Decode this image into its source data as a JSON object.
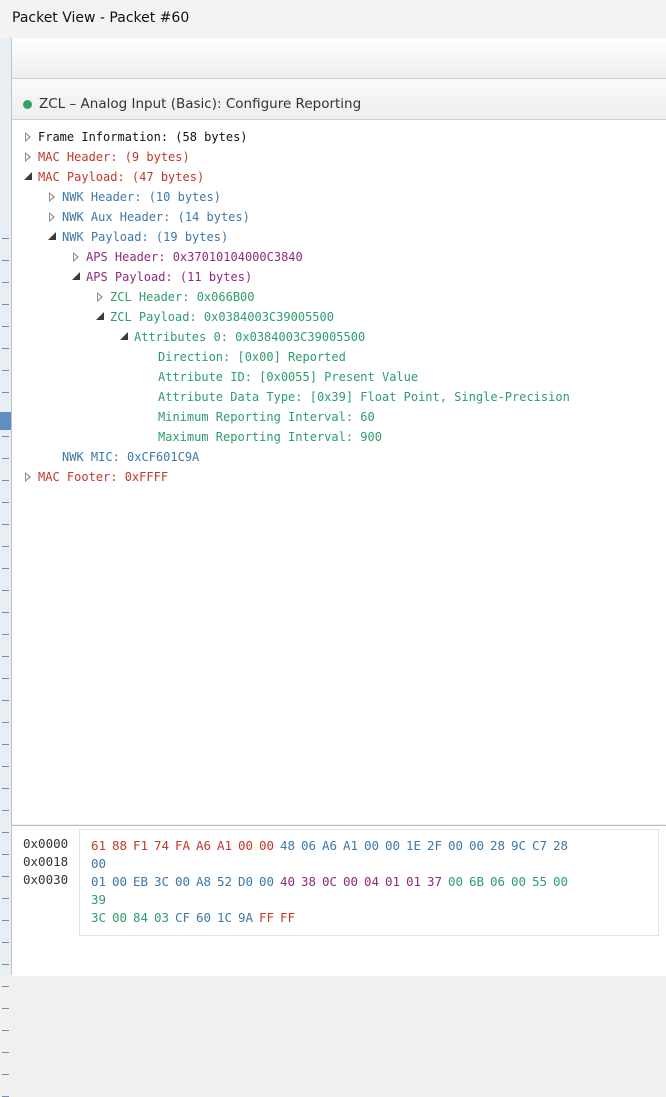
{
  "window": {
    "title": "Packet View - Packet #60"
  },
  "summary": {
    "title": "ZCL – Analog Input (Basic): Configure Reporting",
    "status_color": "#2fa36b"
  },
  "tree": [
    {
      "label": "Frame Information: (58 bytes)",
      "toggle": "collapsed",
      "color": "black"
    },
    {
      "label": "MAC Header: (9 bytes)",
      "toggle": "collapsed",
      "color": "red"
    },
    {
      "label": "MAC Payload: (47 bytes)",
      "toggle": "expanded",
      "color": "red"
    },
    {
      "label": "NWK Header: (10 bytes)",
      "toggle": "collapsed",
      "color": "blue"
    },
    {
      "label": "NWK Aux Header: (14 bytes)",
      "toggle": "collapsed",
      "color": "blue"
    },
    {
      "label": "NWK Payload: (19 bytes)",
      "toggle": "expanded",
      "color": "blue"
    },
    {
      "label": "APS Header: 0x37010104000C3840",
      "toggle": "collapsed",
      "color": "purple"
    },
    {
      "label": "APS Payload: (11 bytes)",
      "toggle": "expanded",
      "color": "purple"
    },
    {
      "label": "ZCL Header: 0x066B00",
      "toggle": "collapsed",
      "color": "green"
    },
    {
      "label": "ZCL Payload: 0x0384003C39005500",
      "toggle": "expanded",
      "color": "green"
    },
    {
      "label": "Attributes 0: 0x0384003C39005500",
      "toggle": "expanded",
      "color": "green"
    },
    {
      "label": "Direction: [0x00] Reported",
      "toggle": "none",
      "color": "green"
    },
    {
      "label": "Attribute ID: [0x0055] Present Value",
      "toggle": "none",
      "color": "green"
    },
    {
      "label": "Attribute Data Type: [0x39] Float Point, Single-Precision",
      "toggle": "none",
      "color": "green"
    },
    {
      "label": "Minimum Reporting Interval: 60",
      "toggle": "none",
      "color": "green"
    },
    {
      "label": "Maximum Reporting Interval: 900",
      "toggle": "none",
      "color": "green"
    },
    {
      "label": "NWK MIC: 0xCF601C9A",
      "toggle": "none",
      "color": "blue"
    },
    {
      "label": "MAC Footer: 0xFFFF",
      "toggle": "collapsed",
      "color": "red"
    }
  ],
  "hex": {
    "offsets": [
      "0x0000",
      "0x0018",
      "0x0030"
    ],
    "lines": [
      {
        "bytes": [
          "61",
          "88",
          "F1",
          "74",
          "FA",
          "A6",
          "A1",
          "00",
          "00",
          "48",
          "06",
          "A6",
          "A1",
          "00",
          "00",
          "1E",
          "2F",
          "00",
          "00",
          "28",
          "9C",
          "C7",
          "28"
        ],
        "colors": [
          "red",
          "red",
          "red",
          "red",
          "red",
          "red",
          "red",
          "red",
          "red",
          "blue",
          "blue",
          "blue",
          "blue",
          "blue",
          "blue",
          "blue",
          "blue",
          "blue",
          "blue",
          "blue",
          "blue",
          "blue",
          "blue"
        ]
      },
      {
        "bytes": [
          "00"
        ],
        "colors": [
          "blue"
        ]
      },
      {
        "bytes": [
          "01",
          "00",
          "EB",
          "3C",
          "00",
          "A8",
          "52",
          "D0",
          "00",
          "40",
          "38",
          "0C",
          "00",
          "04",
          "01",
          "01",
          "37",
          "00",
          "6B",
          "06",
          "00",
          "55",
          "00"
        ],
        "colors": [
          "blue",
          "blue",
          "blue",
          "blue",
          "blue",
          "blue",
          "blue",
          "blue",
          "blue",
          "purple",
          "purple",
          "purple",
          "purple",
          "purple",
          "purple",
          "purple",
          "purple",
          "green",
          "green",
          "green",
          "green",
          "green",
          "green"
        ]
      },
      {
        "bytes": [
          "39"
        ],
        "colors": [
          "green"
        ]
      },
      {
        "bytes": [
          "3C",
          "00",
          "84",
          "03",
          "CF",
          "60",
          "1C",
          "9A",
          "FF",
          "FF"
        ],
        "colors": [
          "green",
          "green",
          "green",
          "green",
          "blue",
          "blue",
          "blue",
          "blue",
          "red",
          "red"
        ]
      }
    ]
  },
  "colors": {
    "red": "#c0392b",
    "blue": "#3c78a8",
    "purple": "#8e2a7e",
    "green": "#2e9c6a",
    "black": "#111111"
  }
}
